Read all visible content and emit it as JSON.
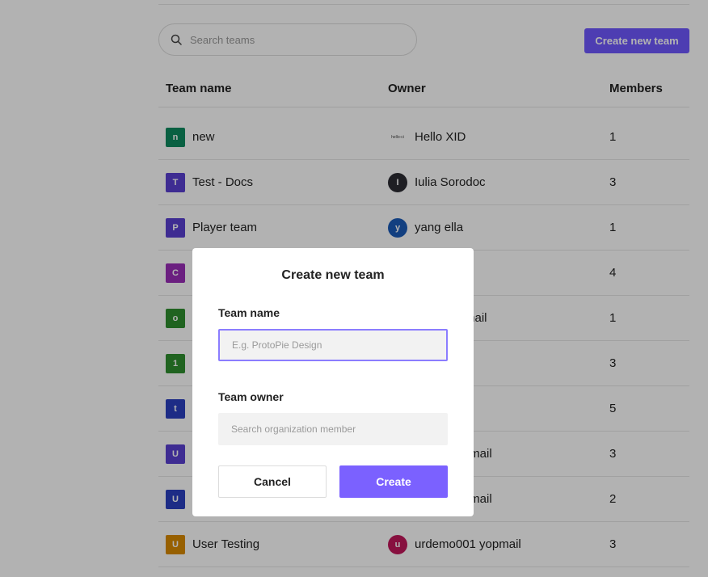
{
  "search": {
    "placeholder": "Search teams",
    "icon": "search-icon"
  },
  "toolbar": {
    "create_new_team_label": "Create new team",
    "accent_color": "#6f58ff"
  },
  "table": {
    "columns": [
      "Team name",
      "Owner",
      "Members"
    ],
    "rows": [
      {
        "avatar_letter": "n",
        "avatar_color": "#0e8a5f",
        "team": "new",
        "owner_avatar": "hello-ci",
        "owner_avatar_color": "#ffffff",
        "owner": "Hello XID",
        "members": "1"
      },
      {
        "avatar_letter": "T",
        "avatar_color": "#5a3fd1",
        "team": "Test - Docs",
        "owner_avatar": "I",
        "owner_avatar_color": "#2b2b33",
        "owner": "Iulia Sorodoc",
        "members": "3"
      },
      {
        "avatar_letter": "P",
        "avatar_color": "#5a3fd1",
        "team": "Player team",
        "owner_avatar": "y",
        "owner_avatar_color": "#1a5bb8",
        "owner": "yang ella",
        "members": "1"
      },
      {
        "avatar_letter": "C",
        "avatar_color": "#9a2db8",
        "team": "",
        "owner_avatar": "",
        "owner_avatar_color": "",
        "owner": "",
        "members": "4"
      },
      {
        "avatar_letter": "o",
        "avatar_color": "#2f8f2f",
        "team": "",
        "owner_avatar": "",
        "owner_avatar_color": "",
        "owner": "mail",
        "members": "1"
      },
      {
        "avatar_letter": "1",
        "avatar_color": "#2f8f2f",
        "team": "",
        "owner_avatar": "",
        "owner_avatar_color": "",
        "owner": "",
        "members": "3"
      },
      {
        "avatar_letter": "t",
        "avatar_color": "#2a3fc1",
        "team": "",
        "owner_avatar": "",
        "owner_avatar_color": "",
        "owner": "",
        "members": "5"
      },
      {
        "avatar_letter": "U",
        "avatar_color": "#5a3fd1",
        "team": "",
        "owner_avatar": "",
        "owner_avatar_color": "",
        "owner": "yopmail",
        "members": "3"
      },
      {
        "avatar_letter": "U",
        "avatar_color": "#2a3fc1",
        "team": "",
        "owner_avatar": "",
        "owner_avatar_color": "",
        "owner": "yopmail",
        "members": "2"
      },
      {
        "avatar_letter": "U",
        "avatar_color": "#d98a00",
        "team": "User Testing",
        "owner_avatar": "u",
        "owner_avatar_color": "#c2185b",
        "owner": "urdemo001 yopmail",
        "members": "3"
      }
    ]
  },
  "modal": {
    "title": "Create new team",
    "team_name_label": "Team name",
    "team_name_placeholder": "E.g. ProtoPie Design",
    "team_owner_label": "Team owner",
    "team_owner_placeholder": "Search organization member",
    "cancel_label": "Cancel",
    "create_label": "Create",
    "create_color": "#7b61ff"
  }
}
